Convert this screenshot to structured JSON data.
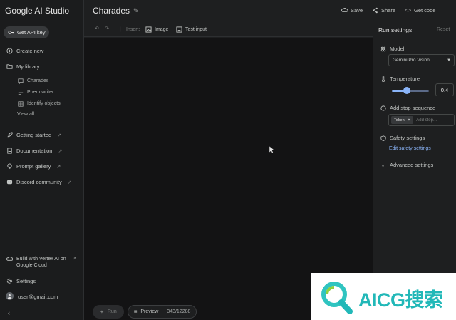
{
  "app": {
    "title": "Google AI Studio"
  },
  "sidebar": {
    "get_api_key": "Get API key",
    "create_new": "Create new",
    "my_library": "My library",
    "library_items": [
      {
        "label": "Charades",
        "icon": "chat-icon"
      },
      {
        "label": "Poem writer",
        "icon": "text-icon"
      },
      {
        "label": "Identify objects",
        "icon": "grid-icon"
      }
    ],
    "view_all": "View all",
    "links": [
      {
        "label": "Getting started",
        "icon": "rocket-icon"
      },
      {
        "label": "Documentation",
        "icon": "document-icon"
      },
      {
        "label": "Prompt gallery",
        "icon": "bulb-icon"
      },
      {
        "label": "Discord community",
        "icon": "discord-icon"
      }
    ],
    "vertex": "Build with Vertex AI on Google Cloud",
    "settings": "Settings",
    "user": "user@gmail.com"
  },
  "header": {
    "prompt_title": "Charades",
    "save": "Save",
    "share": "Share",
    "get_code": "Get code"
  },
  "toolbar": {
    "insert": "Insert:",
    "image": "Image",
    "test_input": "Test input"
  },
  "footer": {
    "run": "Run",
    "preview": "Preview",
    "token_count": "343/12288"
  },
  "run_settings": {
    "title": "Run settings",
    "reset": "Reset",
    "model_label": "Model",
    "model_value": "Gemini Pro Vision",
    "temperature_label": "Temperature",
    "temperature_value": "0.4",
    "temperature_fraction": 0.4,
    "stop_label": "Add stop sequence",
    "stop_chip": "Token",
    "stop_placeholder": "Add stop...",
    "safety_label": "Safety settings",
    "edit_safety": "Edit safety settings",
    "advanced": "Advanced settings"
  },
  "watermark": {
    "text": "AICG搜索"
  },
  "colors": {
    "accent": "#8ab4f8",
    "background": "#1e1f20",
    "canvas": "#131314"
  }
}
